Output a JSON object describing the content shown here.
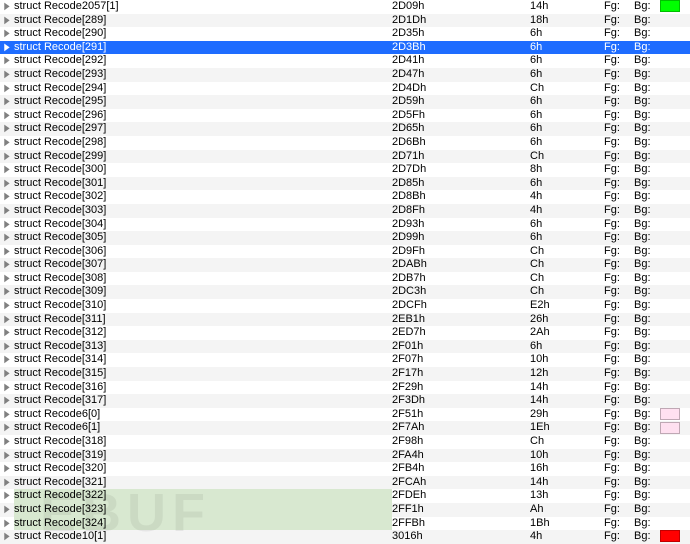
{
  "fg_label": "Fg:",
  "bg_label": "Bg:",
  "watermark": "EBUF",
  "rows": [
    {
      "name": "struct Recode2057[1]",
      "offset": "2D09h",
      "size": "14h",
      "sw": "#00ff00"
    },
    {
      "name": "struct Recode[289]",
      "offset": "2D1Dh",
      "size": "18h"
    },
    {
      "name": "struct Recode[290]",
      "offset": "2D35h",
      "size": "6h"
    },
    {
      "name": "struct Recode[291]",
      "offset": "2D3Bh",
      "size": "6h",
      "selected": true
    },
    {
      "name": "struct Recode[292]",
      "offset": "2D41h",
      "size": "6h"
    },
    {
      "name": "struct Recode[293]",
      "offset": "2D47h",
      "size": "6h"
    },
    {
      "name": "struct Recode[294]",
      "offset": "2D4Dh",
      "size": "Ch"
    },
    {
      "name": "struct Recode[295]",
      "offset": "2D59h",
      "size": "6h"
    },
    {
      "name": "struct Recode[296]",
      "offset": "2D5Fh",
      "size": "6h"
    },
    {
      "name": "struct Recode[297]",
      "offset": "2D65h",
      "size": "6h"
    },
    {
      "name": "struct Recode[298]",
      "offset": "2D6Bh",
      "size": "6h"
    },
    {
      "name": "struct Recode[299]",
      "offset": "2D71h",
      "size": "Ch"
    },
    {
      "name": "struct Recode[300]",
      "offset": "2D7Dh",
      "size": "8h"
    },
    {
      "name": "struct Recode[301]",
      "offset": "2D85h",
      "size": "6h"
    },
    {
      "name": "struct Recode[302]",
      "offset": "2D8Bh",
      "size": "4h"
    },
    {
      "name": "struct Recode[303]",
      "offset": "2D8Fh",
      "size": "4h"
    },
    {
      "name": "struct Recode[304]",
      "offset": "2D93h",
      "size": "6h"
    },
    {
      "name": "struct Recode[305]",
      "offset": "2D99h",
      "size": "6h"
    },
    {
      "name": "struct Recode[306]",
      "offset": "2D9Fh",
      "size": "Ch"
    },
    {
      "name": "struct Recode[307]",
      "offset": "2DABh",
      "size": "Ch"
    },
    {
      "name": "struct Recode[308]",
      "offset": "2DB7h",
      "size": "Ch"
    },
    {
      "name": "struct Recode[309]",
      "offset": "2DC3h",
      "size": "Ch"
    },
    {
      "name": "struct Recode[310]",
      "offset": "2DCFh",
      "size": "E2h"
    },
    {
      "name": "struct Recode[311]",
      "offset": "2EB1h",
      "size": "26h"
    },
    {
      "name": "struct Recode[312]",
      "offset": "2ED7h",
      "size": "2Ah"
    },
    {
      "name": "struct Recode[313]",
      "offset": "2F01h",
      "size": "6h"
    },
    {
      "name": "struct Recode[314]",
      "offset": "2F07h",
      "size": "10h"
    },
    {
      "name": "struct Recode[315]",
      "offset": "2F17h",
      "size": "12h"
    },
    {
      "name": "struct Recode[316]",
      "offset": "2F29h",
      "size": "14h"
    },
    {
      "name": "struct Recode[317]",
      "offset": "2F3Dh",
      "size": "14h"
    },
    {
      "name": "struct Recode6[0]",
      "offset": "2F51h",
      "size": "29h",
      "sw": "#ffe0f0"
    },
    {
      "name": "struct Recode6[1]",
      "offset": "2F7Ah",
      "size": "1Eh",
      "sw": "#ffe0f0"
    },
    {
      "name": "struct Recode[318]",
      "offset": "2F98h",
      "size": "Ch"
    },
    {
      "name": "struct Recode[319]",
      "offset": "2FA4h",
      "size": "10h"
    },
    {
      "name": "struct Recode[320]",
      "offset": "2FB4h",
      "size": "16h"
    },
    {
      "name": "struct Recode[321]",
      "offset": "2FCAh",
      "size": "14h"
    },
    {
      "name": "struct Recode[322]",
      "offset": "2FDEh",
      "size": "13h",
      "hl": true
    },
    {
      "name": "struct Recode[323]",
      "offset": "2FF1h",
      "size": "Ah",
      "hl": true
    },
    {
      "name": "struct Recode[324]",
      "offset": "2FFBh",
      "size": "1Bh",
      "hl": true
    },
    {
      "name": "struct Recode10[1]",
      "offset": "3016h",
      "size": "4h",
      "sw": "#ff0000"
    }
  ]
}
